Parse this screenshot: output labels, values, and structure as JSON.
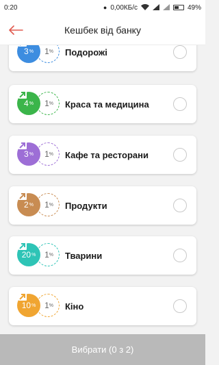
{
  "status": {
    "time": "0:20",
    "speed": "0,00КБ/с",
    "battery": "49%"
  },
  "header": {
    "title": "Кешбек від банку"
  },
  "categories": [
    {
      "label": "Подорожі",
      "percent": "3",
      "extra": "1",
      "color": "#3d8de0"
    },
    {
      "label": "Краса та медицина",
      "percent": "4",
      "extra": "1",
      "color": "#3bb54a"
    },
    {
      "label": "Кафе та ресторани",
      "percent": "3",
      "extra": "1",
      "color": "#9d6ed6"
    },
    {
      "label": "Продукти",
      "percent": "2",
      "extra": "1",
      "color": "#c88c52"
    },
    {
      "label": "Тварини",
      "percent": "20",
      "extra": "1",
      "color": "#2ec4b6"
    },
    {
      "label": "Кіно",
      "percent": "10",
      "extra": "1",
      "color": "#f0a531"
    }
  ],
  "percent_sign": "%",
  "footer": {
    "button_label": "Вибрати (0 з 2)"
  }
}
